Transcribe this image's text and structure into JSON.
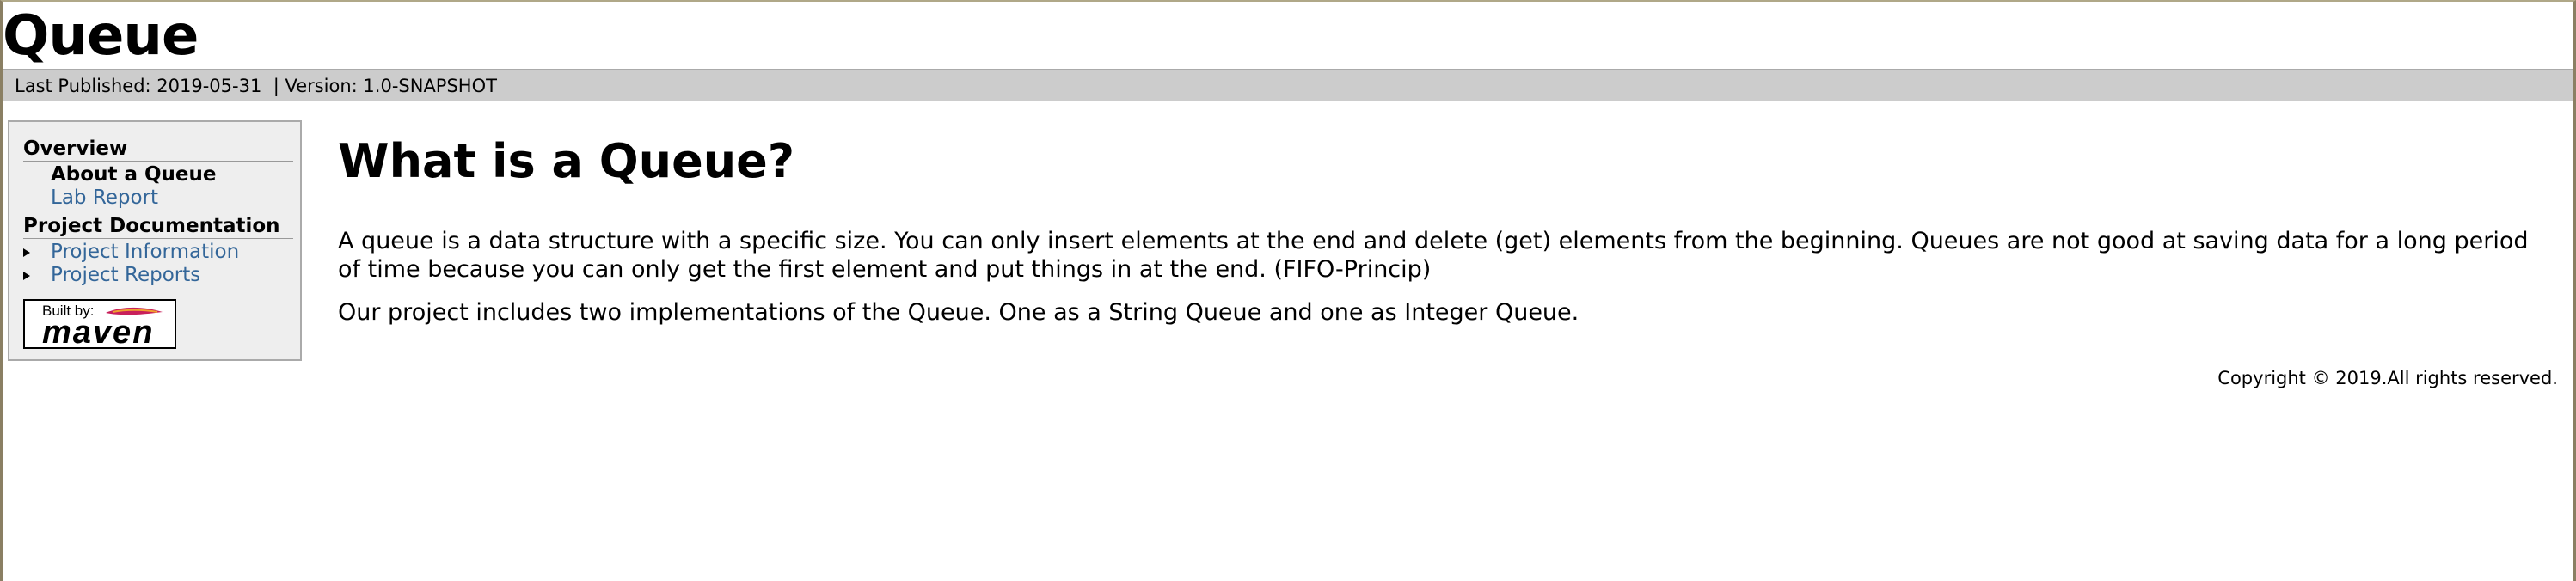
{
  "banner": {
    "title": "Queue"
  },
  "breadcrumbs": {
    "published": "Last Published: 2019-05-31",
    "separator": "|",
    "version": "Version: 1.0-SNAPSHOT"
  },
  "menu": {
    "sections": [
      {
        "heading": "Overview",
        "items": [
          {
            "label": "About a Queue",
            "active": true
          },
          {
            "label": "Lab Report",
            "active": false
          }
        ]
      },
      {
        "heading": "Project Documentation",
        "items": [
          {
            "label": "Project Information",
            "expandable": true
          },
          {
            "label": "Project Reports",
            "expandable": true
          }
        ]
      }
    ]
  },
  "badge": {
    "built_by": "Built by:",
    "word": "maven"
  },
  "content": {
    "title": "What is a Queue?",
    "paragraphs": [
      "A queue is a data structure with a specific size. You can only insert elements at the end and delete (get) elements from the beginning. Queues are not good at saving data for a long period of time because you can only get the first element and put things in at the end. (FIFO-Princip)",
      "Our project includes two implementations of the Queue. One as a String Queue and one as Integer Queue."
    ]
  },
  "footer": {
    "copyright": "Copyright © 2019.All rights reserved."
  },
  "colors": {
    "link": "#336699",
    "breadcrumb_bg": "#cccccc",
    "menu_bg": "#eeeeee"
  }
}
